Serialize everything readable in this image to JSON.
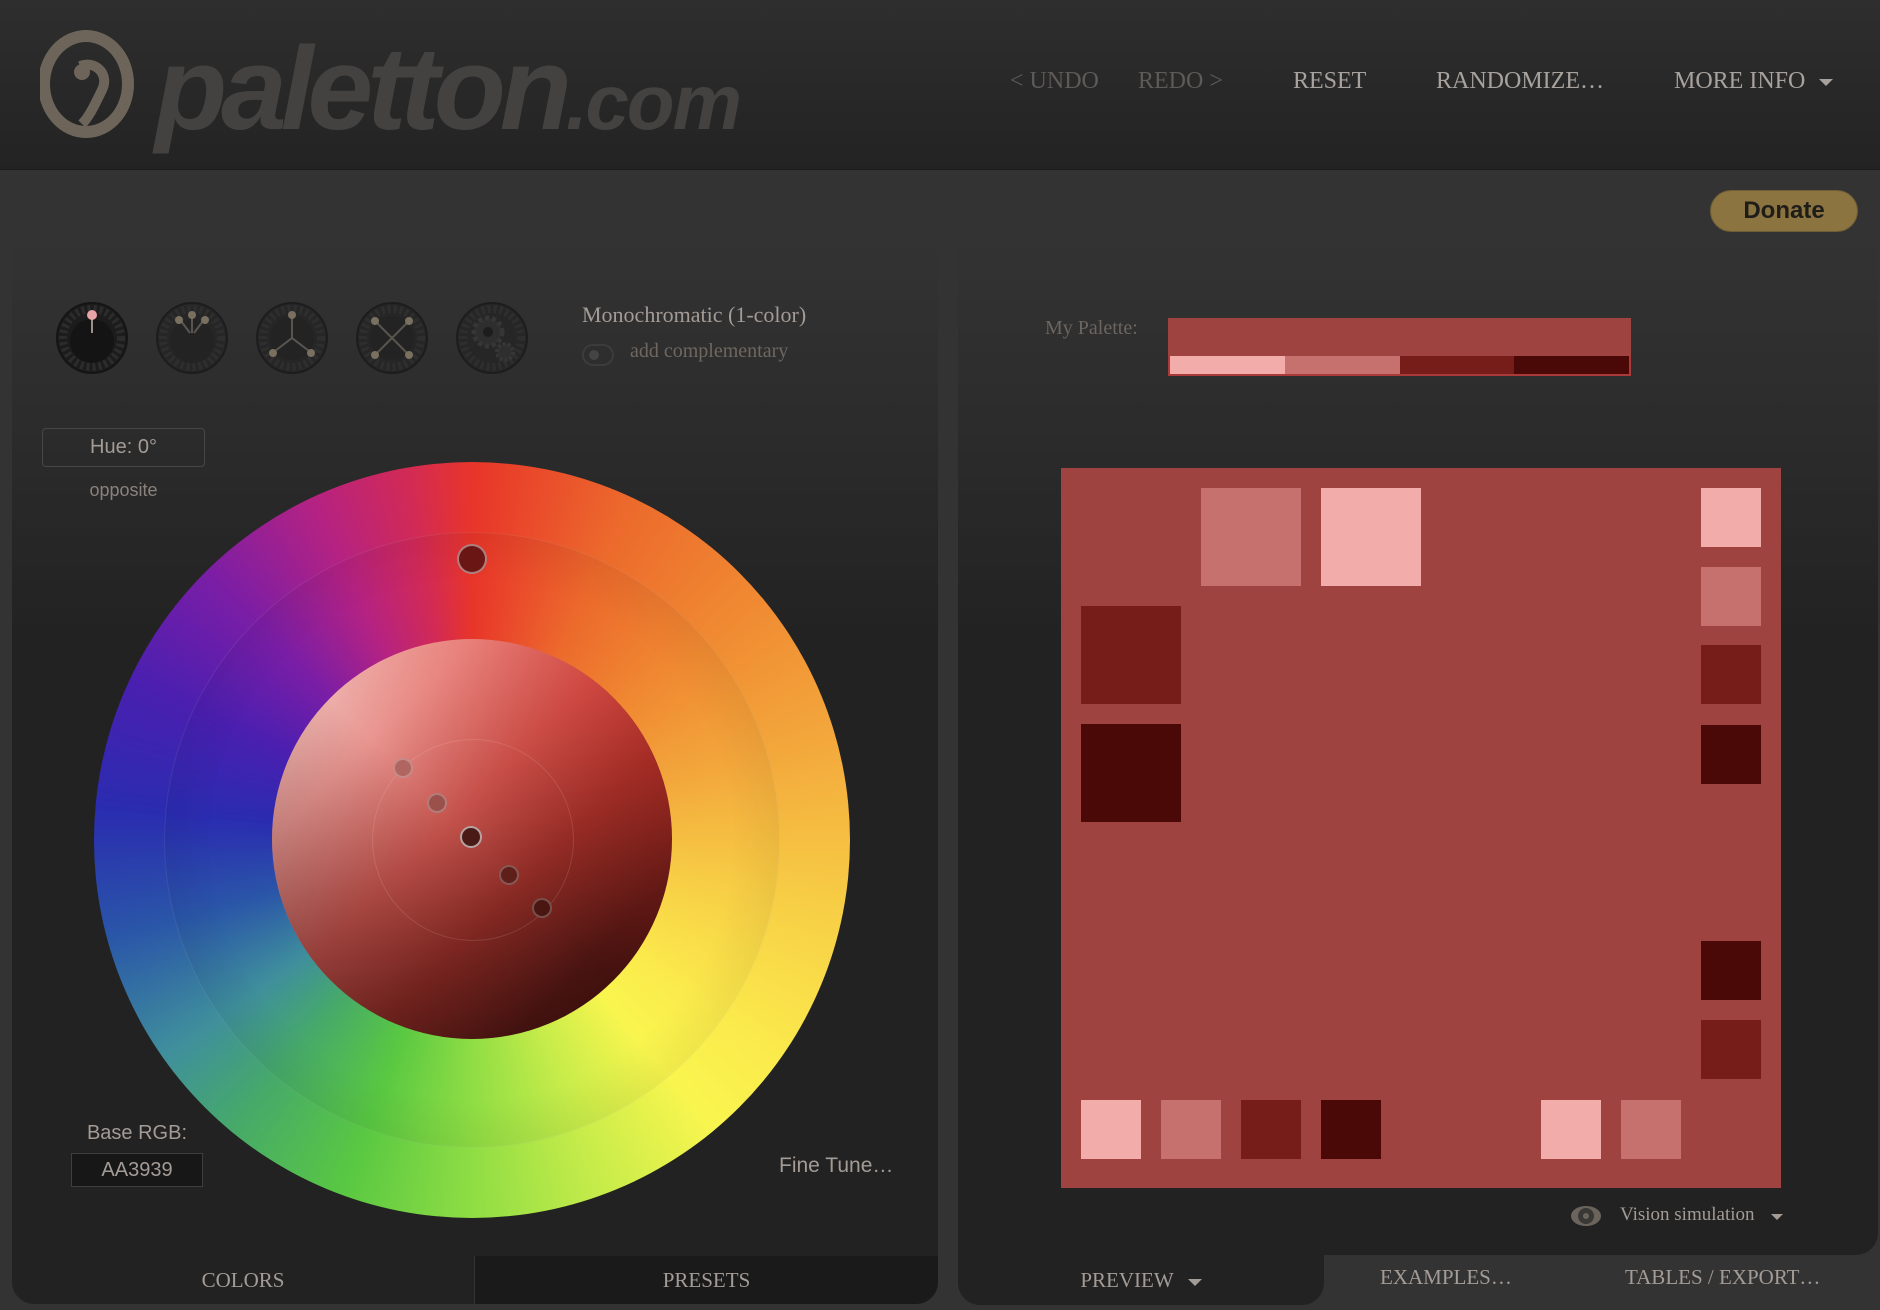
{
  "header": {
    "logo_main": "paletton",
    "logo_suffix": ".com",
    "nav": {
      "undo": "< UNDO",
      "redo": "REDO >",
      "reset": "RESET",
      "randomize": "RANDOMIZE…",
      "more_info": "MORE INFO"
    }
  },
  "donate_label": "Donate",
  "scheme": {
    "title": "Monochromatic (1-color)",
    "add_complementary_label": "add complementary",
    "add_complementary_on": false,
    "modes": [
      {
        "name": "monochromatic",
        "selected": true
      },
      {
        "name": "adjacent",
        "selected": false
      },
      {
        "name": "triad",
        "selected": false
      },
      {
        "name": "tetrad",
        "selected": false
      },
      {
        "name": "free-style",
        "selected": false
      }
    ]
  },
  "hue": {
    "label": "Hue: 0°",
    "opposite_label": "opposite"
  },
  "base_rgb": {
    "label": "Base RGB:",
    "value": "AA3939"
  },
  "fine_tune_label": "Fine Tune…",
  "left_tabs": {
    "colors": "COLORS",
    "presets": "PRESETS"
  },
  "palette": {
    "label": "My Palette:",
    "main_color": "#9e4340",
    "shades": [
      "#f2adab",
      "#c7716e",
      "#761d19",
      "#4a0906"
    ]
  },
  "preview": {
    "background": "#9e4340"
  },
  "vision": {
    "label": "Vision simulation"
  },
  "right_tabs": {
    "preview": "PREVIEW",
    "examples": "EXAMPLES…",
    "tables_export": "TABLES / EXPORT…"
  }
}
